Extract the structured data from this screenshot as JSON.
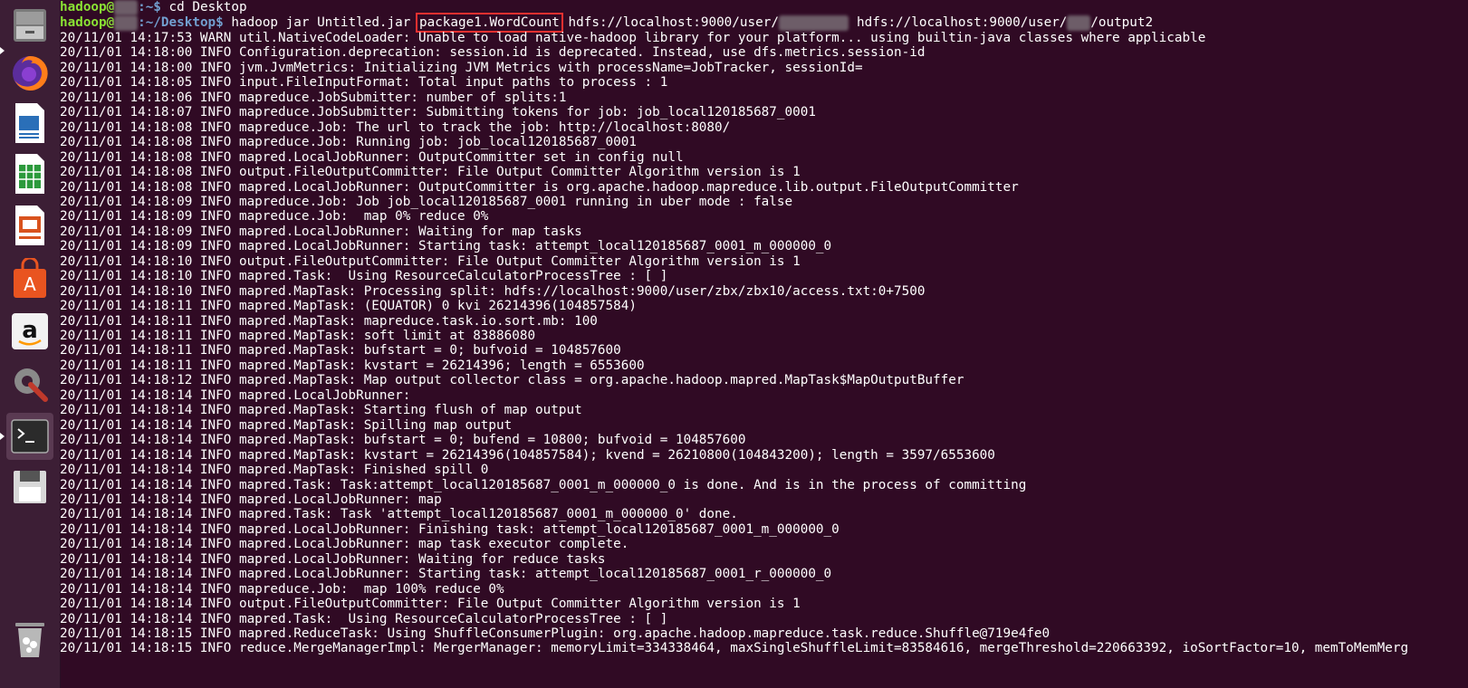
{
  "launcher": {
    "items": [
      {
        "name": "files-icon"
      },
      {
        "name": "firefox-icon"
      },
      {
        "name": "libreoffice-writer-icon"
      },
      {
        "name": "libreoffice-calc-icon"
      },
      {
        "name": "libreoffice-impress-icon"
      },
      {
        "name": "ubuntu-software-icon"
      },
      {
        "name": "amazon-icon"
      },
      {
        "name": "system-settings-icon"
      },
      {
        "name": "terminal-icon"
      },
      {
        "name": "save-disk-icon"
      },
      {
        "name": "trash-icon"
      }
    ]
  },
  "terminal": {
    "prompt1": {
      "user": "hadoop@",
      "path": ":~$ ",
      "cmd": "cd Desktop"
    },
    "prompt2": {
      "user": "hadoop@",
      "path": ":~/Desktop$ ",
      "cmd_pre": "hadoop jar Untitled.jar ",
      "cmd_hl": "package1.WordCount",
      "cmd_mid": " hdfs://localhost:9000/user/",
      "cmd_mid2": " hdfs://localhost:9000/user/",
      "cmd_post": "/output2"
    },
    "lines": [
      "20/11/01 14:17:53 WARN util.NativeCodeLoader: Unable to load native-hadoop library for your platform... using builtin-java classes where applicable",
      "20/11/01 14:18:00 INFO Configuration.deprecation: session.id is deprecated. Instead, use dfs.metrics.session-id",
      "20/11/01 14:18:00 INFO jvm.JvmMetrics: Initializing JVM Metrics with processName=JobTracker, sessionId=",
      "20/11/01 14:18:05 INFO input.FileInputFormat: Total input paths to process : 1",
      "20/11/01 14:18:06 INFO mapreduce.JobSubmitter: number of splits:1",
      "20/11/01 14:18:07 INFO mapreduce.JobSubmitter: Submitting tokens for job: job_local120185687_0001",
      "20/11/01 14:18:08 INFO mapreduce.Job: The url to track the job: http://localhost:8080/",
      "20/11/01 14:18:08 INFO mapreduce.Job: Running job: job_local120185687_0001",
      "20/11/01 14:18:08 INFO mapred.LocalJobRunner: OutputCommitter set in config null",
      "20/11/01 14:18:08 INFO output.FileOutputCommitter: File Output Committer Algorithm version is 1",
      "20/11/01 14:18:08 INFO mapred.LocalJobRunner: OutputCommitter is org.apache.hadoop.mapreduce.lib.output.FileOutputCommitter",
      "20/11/01 14:18:09 INFO mapreduce.Job: Job job_local120185687_0001 running in uber mode : false",
      "20/11/01 14:18:09 INFO mapreduce.Job:  map 0% reduce 0%",
      "20/11/01 14:18:09 INFO mapred.LocalJobRunner: Waiting for map tasks",
      "20/11/01 14:18:09 INFO mapred.LocalJobRunner: Starting task: attempt_local120185687_0001_m_000000_0",
      "20/11/01 14:18:10 INFO output.FileOutputCommitter: File Output Committer Algorithm version is 1",
      "20/11/01 14:18:10 INFO mapred.Task:  Using ResourceCalculatorProcessTree : [ ]",
      "20/11/01 14:18:10 INFO mapred.MapTask: Processing split: hdfs://localhost:9000/user/zbx/zbx10/access.txt:0+7500",
      "20/11/01 14:18:11 INFO mapred.MapTask: (EQUATOR) 0 kvi 26214396(104857584)",
      "20/11/01 14:18:11 INFO mapred.MapTask: mapreduce.task.io.sort.mb: 100",
      "20/11/01 14:18:11 INFO mapred.MapTask: soft limit at 83886080",
      "20/11/01 14:18:11 INFO mapred.MapTask: bufstart = 0; bufvoid = 104857600",
      "20/11/01 14:18:11 INFO mapred.MapTask: kvstart = 26214396; length = 6553600",
      "20/11/01 14:18:12 INFO mapred.MapTask: Map output collector class = org.apache.hadoop.mapred.MapTask$MapOutputBuffer",
      "20/11/01 14:18:14 INFO mapred.LocalJobRunner:",
      "20/11/01 14:18:14 INFO mapred.MapTask: Starting flush of map output",
      "20/11/01 14:18:14 INFO mapred.MapTask: Spilling map output",
      "20/11/01 14:18:14 INFO mapred.MapTask: bufstart = 0; bufend = 10800; bufvoid = 104857600",
      "20/11/01 14:18:14 INFO mapred.MapTask: kvstart = 26214396(104857584); kvend = 26210800(104843200); length = 3597/6553600",
      "20/11/01 14:18:14 INFO mapred.MapTask: Finished spill 0",
      "20/11/01 14:18:14 INFO mapred.Task: Task:attempt_local120185687_0001_m_000000_0 is done. And is in the process of committing",
      "20/11/01 14:18:14 INFO mapred.LocalJobRunner: map",
      "20/11/01 14:18:14 INFO mapred.Task: Task 'attempt_local120185687_0001_m_000000_0' done.",
      "20/11/01 14:18:14 INFO mapred.LocalJobRunner: Finishing task: attempt_local120185687_0001_m_000000_0",
      "20/11/01 14:18:14 INFO mapred.LocalJobRunner: map task executor complete.",
      "20/11/01 14:18:14 INFO mapred.LocalJobRunner: Waiting for reduce tasks",
      "20/11/01 14:18:14 INFO mapred.LocalJobRunner: Starting task: attempt_local120185687_0001_r_000000_0",
      "20/11/01 14:18:14 INFO mapreduce.Job:  map 100% reduce 0%",
      "20/11/01 14:18:14 INFO output.FileOutputCommitter: File Output Committer Algorithm version is 1",
      "20/11/01 14:18:14 INFO mapred.Task:  Using ResourceCalculatorProcessTree : [ ]",
      "20/11/01 14:18:15 INFO mapred.ReduceTask: Using ShuffleConsumerPlugin: org.apache.hadoop.mapreduce.task.reduce.Shuffle@719e4fe0",
      "20/11/01 14:18:15 INFO reduce.MergeManagerImpl: MergerManager: memoryLimit=334338464, maxSingleShuffleLimit=83584616, mergeThreshold=220663392, ioSortFactor=10, memToMemMerg"
    ]
  }
}
